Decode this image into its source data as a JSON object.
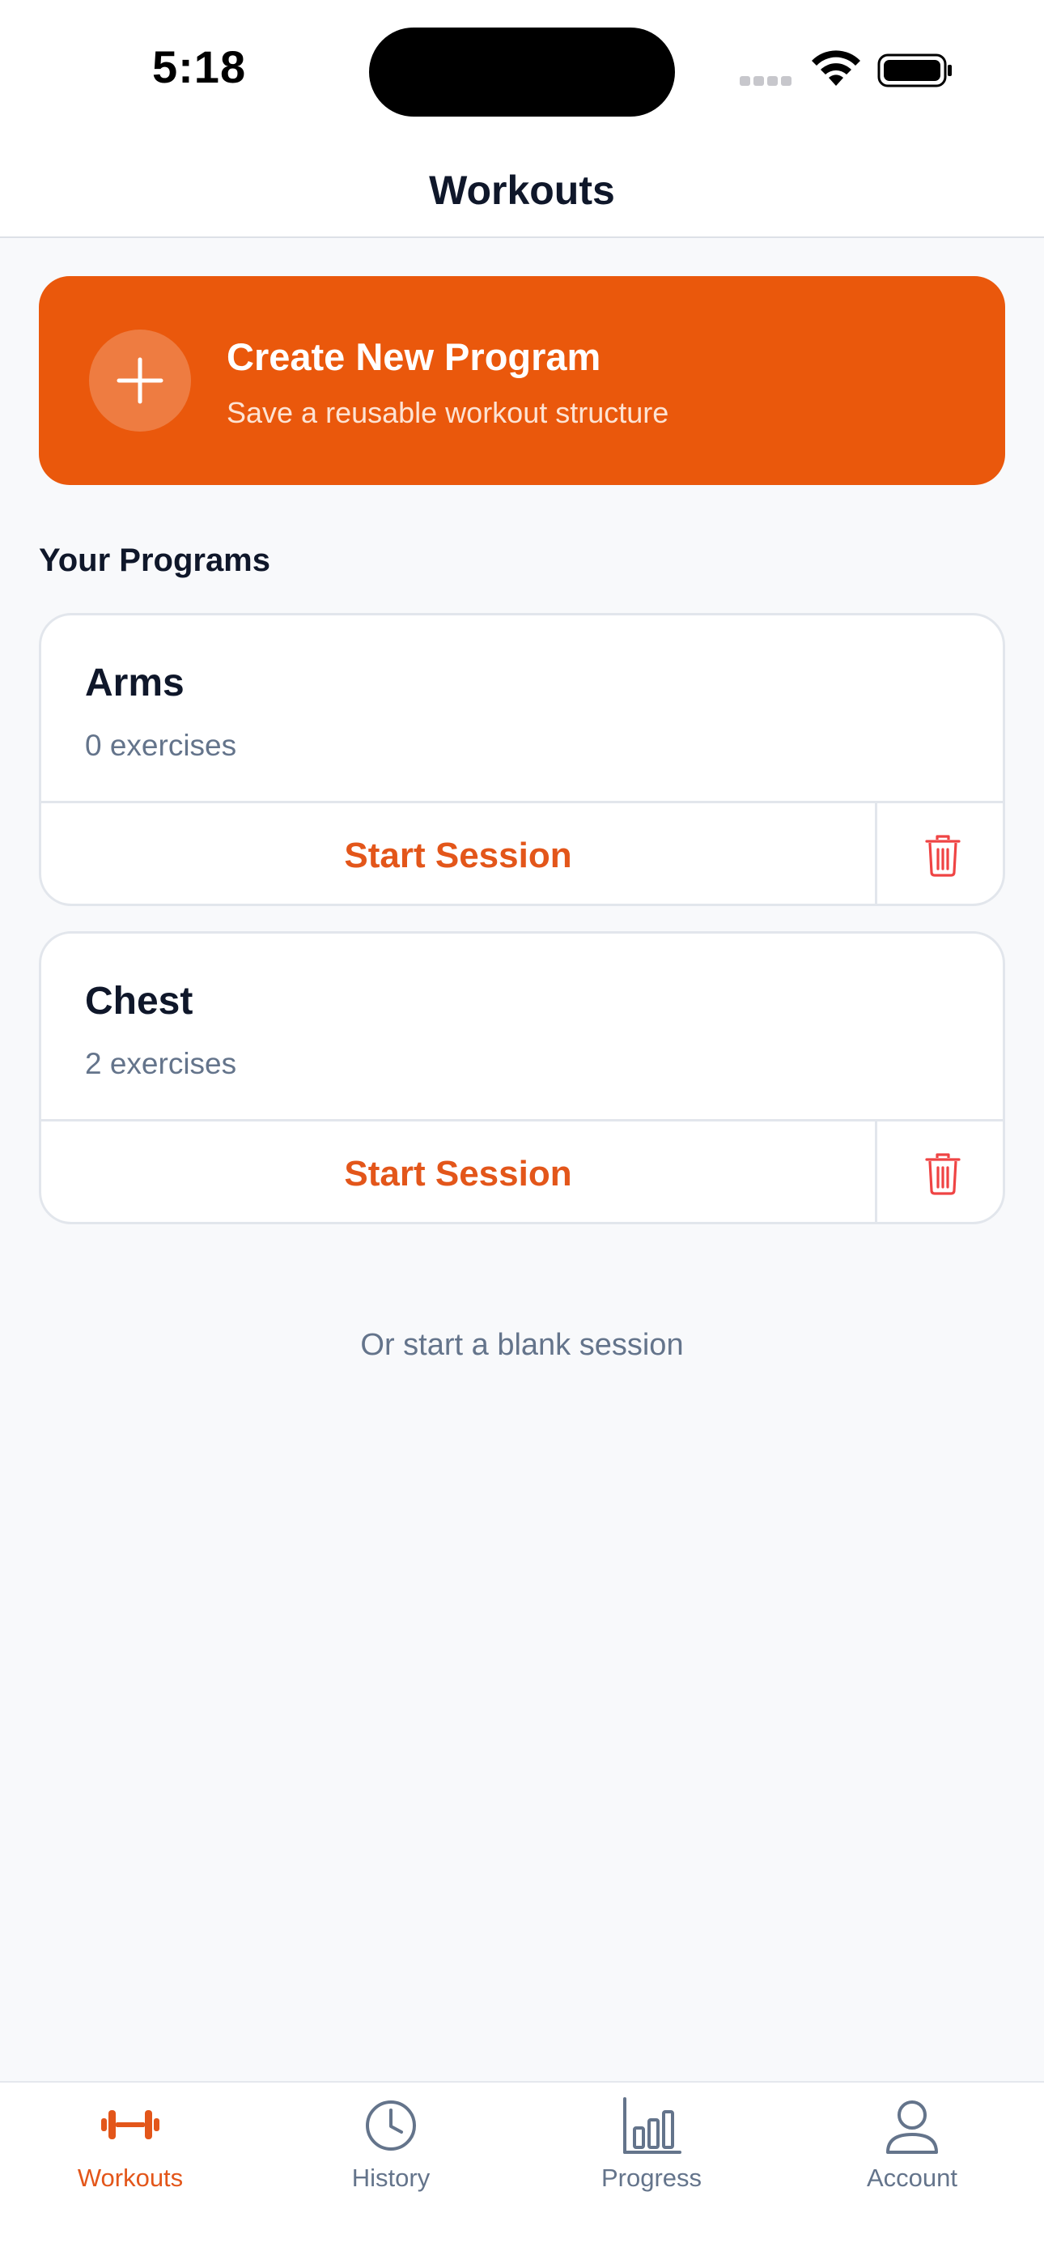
{
  "status_bar": {
    "time": "5:18"
  },
  "header": {
    "title": "Workouts"
  },
  "create_program": {
    "title": "Create New Program",
    "subtitle": "Save a reusable workout structure",
    "icon": "plus-icon"
  },
  "programs_section": {
    "heading": "Your Programs",
    "items": [
      {
        "name": "Arms",
        "count": "0 exercises",
        "start_label": "Start Session",
        "delete_icon": "trash-icon"
      },
      {
        "name": "Chest",
        "count": "2 exercises",
        "start_label": "Start Session",
        "delete_icon": "trash-icon"
      }
    ]
  },
  "blank_session": {
    "label": "Or start a blank session"
  },
  "tab_bar": {
    "tabs": [
      {
        "label": "Workouts",
        "icon": "dumbbell-icon",
        "active": true
      },
      {
        "label": "History",
        "icon": "clock-icon",
        "active": false
      },
      {
        "label": "Progress",
        "icon": "bar-chart-icon",
        "active": false
      },
      {
        "label": "Account",
        "icon": "user-icon",
        "active": false
      }
    ]
  },
  "colors": {
    "accent": "#ea580c",
    "accent_text": "#e3561a",
    "danger": "#ef4444",
    "muted_text": "#64748b",
    "background": "#f8f9fb"
  }
}
